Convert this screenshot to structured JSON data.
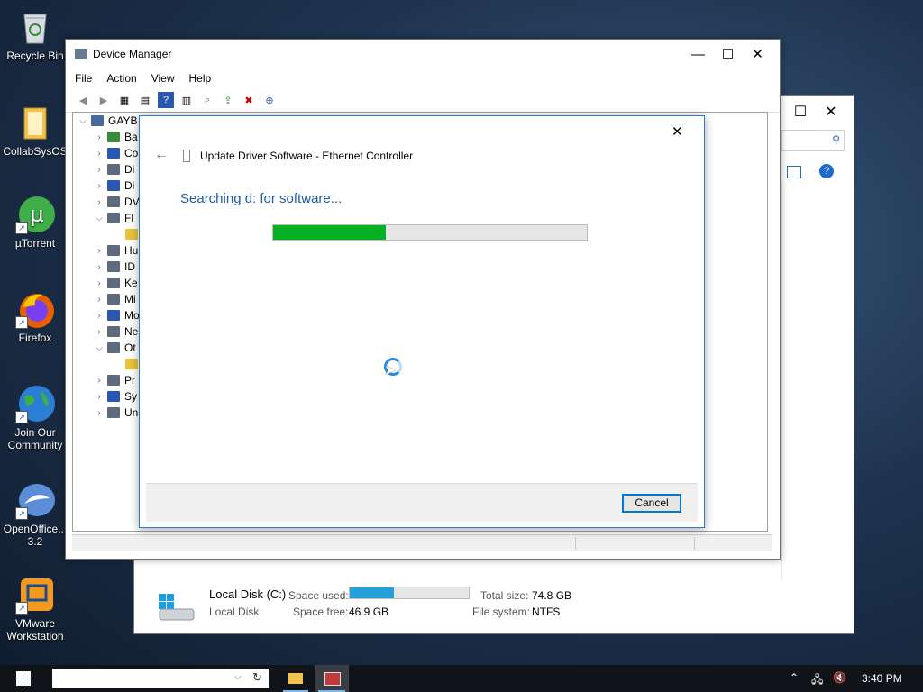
{
  "desktop": {
    "icons": [
      {
        "label": "Recycle Bin"
      },
      {
        "label": "CollabSysOS"
      },
      {
        "label": "µTorrent"
      },
      {
        "label": "Firefox"
      },
      {
        "label": "Join Our Community"
      },
      {
        "label": "OpenOffice... 3.2"
      },
      {
        "label": "VMware Workstation"
      }
    ]
  },
  "explorer": {
    "drive_name": "Local Disk (C:)",
    "drive_type": "Local Disk",
    "space_used_label": "Space used:",
    "space_free_label": "Space free:",
    "space_free_value": "46.9 GB",
    "total_size_label": "Total size:",
    "total_size_value": "74.8 GB",
    "file_system_label": "File system:",
    "file_system_value": "NTFS",
    "space_used_fraction": 0.37
  },
  "device_manager": {
    "title": "Device Manager",
    "menu": [
      "File",
      "Action",
      "View",
      "Help"
    ],
    "tree_root": "GAYB",
    "tree_items": [
      "Ba",
      "Co",
      "Di",
      "Di",
      "DV",
      "Fl",
      "",
      "Hu",
      "ID",
      "Ke",
      "Mi",
      "Mo",
      "Ne",
      "Ot",
      "",
      "Pr",
      "Sy",
      "Un"
    ]
  },
  "wizard": {
    "header": "Update Driver Software - Ethernet Controller",
    "status": "Searching d: for software...",
    "progress_fraction": 0.36,
    "cancel_label": "Cancel"
  },
  "taskbar": {
    "clock": "3:40 PM"
  },
  "colors": {
    "accent": "#0078d7",
    "progress": "#06b025",
    "heading": "#1e5aa8"
  }
}
